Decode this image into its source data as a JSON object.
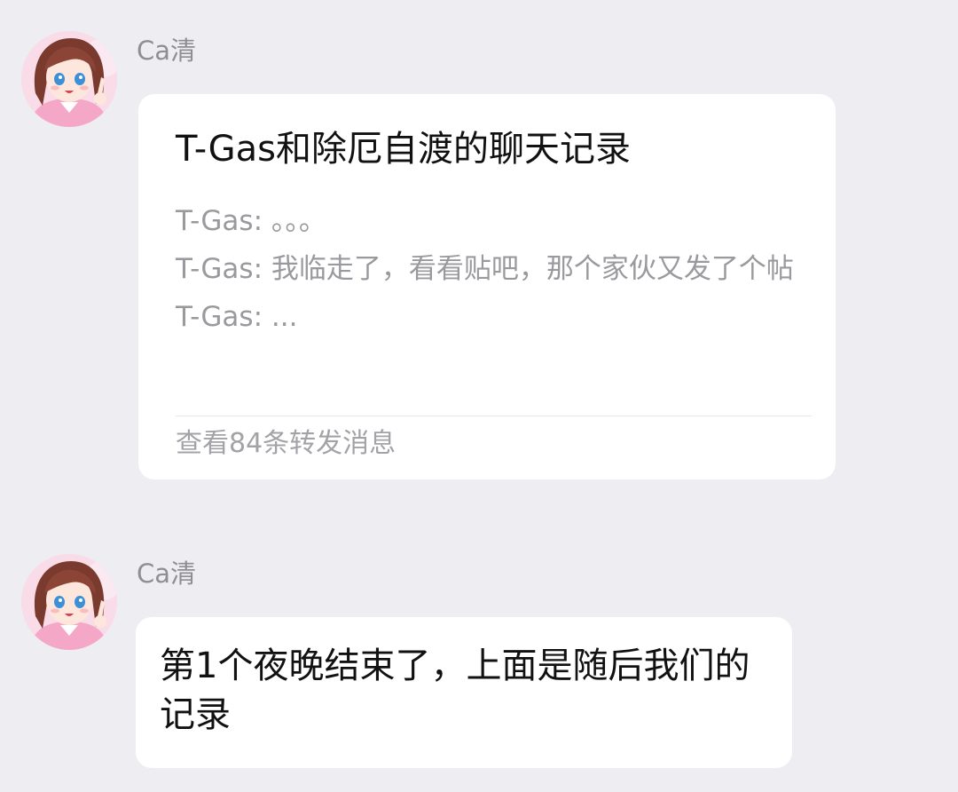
{
  "messages": [
    {
      "sender": "Ca清",
      "avatar_icon": "anime-girl-avatar",
      "type": "forwarded-chat-card",
      "card": {
        "title": "T-Gas和除厄自渡的聊天记录",
        "lines": [
          "T-Gas: 。。。",
          "T-Gas: 我临走了，看看贴吧，那个家伙又发了个帖",
          "T-Gas: ..."
        ],
        "footer": "查看84条转发消息"
      }
    },
    {
      "sender": "Ca清",
      "avatar_icon": "anime-girl-avatar",
      "type": "text",
      "text": "第1个夜晚结束了，上面是随后我们的记录"
    }
  ],
  "colors": {
    "background": "#ededf2",
    "bubble": "#ffffff",
    "sender_name": "#8e8e93",
    "preview_text": "#9a9a9e"
  }
}
